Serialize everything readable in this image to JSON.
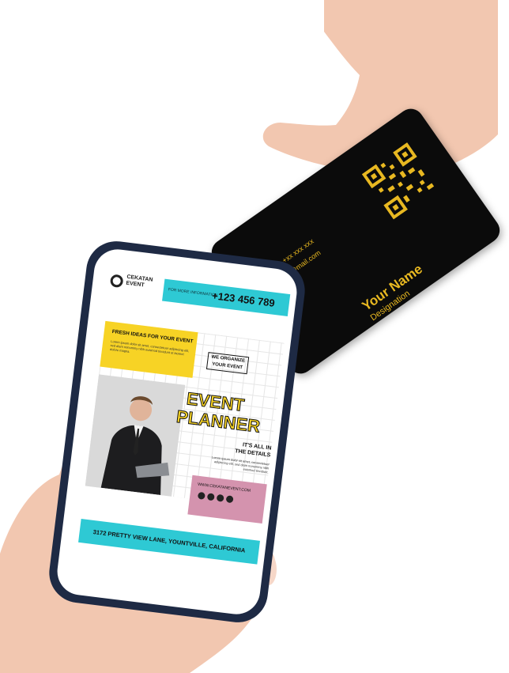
{
  "card": {
    "name": "Your Name",
    "designation": "Designation",
    "phone": "+xx xxx xxx",
    "email": "@mail.com"
  },
  "flyer": {
    "logo_line1": "CEKATAN",
    "logo_line2": "EVENT",
    "info_label": "FOR MORE INFORMATION",
    "phone": "+123 456 789",
    "fresh_ideas": "FRESH IDEAS FOR YOUR EVENT",
    "lorem_1": "Lorem ipsum dolor sit amet, consectetuer adipiscing elit, sed diam nonummy nibh euismod tincidunt ut laoreet dolore magna.",
    "organize_line1": "WE ORGANIZE",
    "organize_line2": "YOUR EVENT",
    "event_title_line1": "EVENT",
    "event_title_line2": "PLANNER",
    "details_line1": "IT'S ALL IN",
    "details_line2": "THE DETAILS",
    "lorem_2": "Lorem ipsum dolor sit amet, consectetuer adipiscing elit, sed diam nonummy nibh euismod tincidunt.",
    "website": "WWW.CEKATANEVENT.COM",
    "address": "3172 PRETTY VIEW LANE, YOUNTVILLE, CALIFORNIA"
  }
}
